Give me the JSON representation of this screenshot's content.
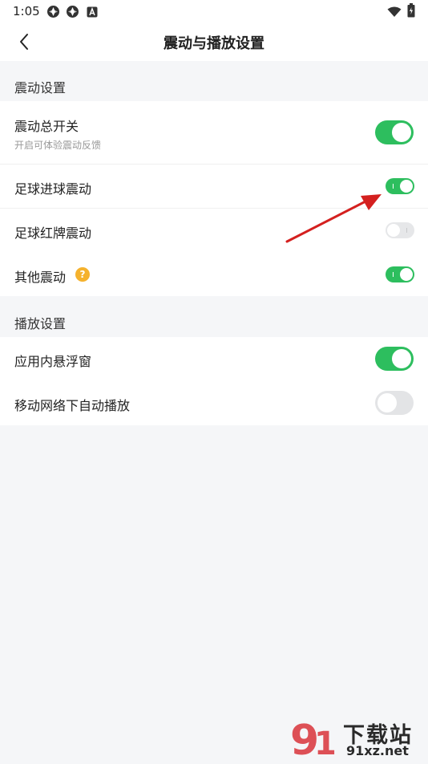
{
  "status_bar": {
    "time": "1:05"
  },
  "header": {
    "title": "震动与播放设置"
  },
  "vibration_section": {
    "title": "震动设置",
    "items": [
      {
        "label": "震动总开关",
        "sublabel": "开启可体验震动反馈",
        "enabled": true
      },
      {
        "label": "足球进球震动",
        "enabled": true
      },
      {
        "label": "足球红牌震动",
        "enabled": false
      },
      {
        "label": "其他震动",
        "enabled": true,
        "help_icon": "?"
      }
    ]
  },
  "playback_section": {
    "title": "播放设置",
    "items": [
      {
        "label": "应用内悬浮窗",
        "enabled": true
      },
      {
        "label": "移动网络下自动播放",
        "enabled": false
      }
    ]
  },
  "watermark": {
    "line1": "下载站",
    "line2": "91xz.net"
  },
  "colors": {
    "accent_green": "#2dbe5e",
    "toggle_off": "#e3e4e6",
    "help_icon": "#f5b22d",
    "arrow_red": "#d4201f",
    "background": "#f5f6f8"
  }
}
